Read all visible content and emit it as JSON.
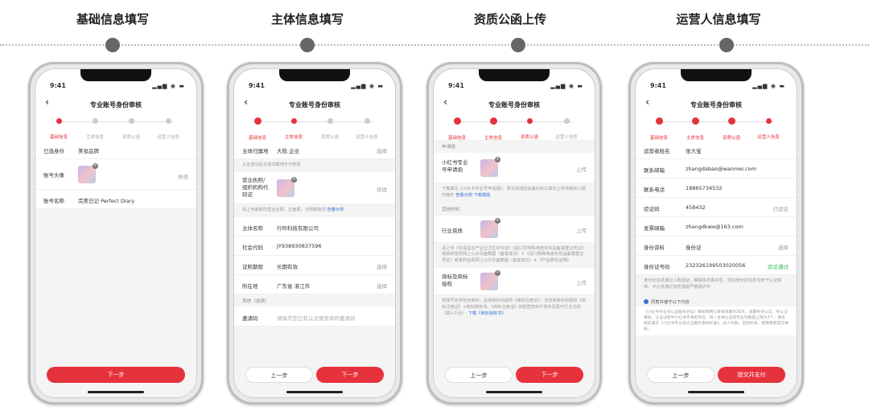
{
  "steps": [
    {
      "title": "基础信息填写"
    },
    {
      "title": "主体信息填写"
    },
    {
      "title": "资质公函上传"
    },
    {
      "title": "运营人信息填写"
    }
  ],
  "common": {
    "time": "9:41",
    "signal": "▂▄▆ ◉ ▬",
    "back": "‹",
    "page_title": "专业账号身份审核",
    "stepper": [
      "基础信息",
      "主体信息",
      "资质公函",
      "运营人信息"
    ],
    "prev_label": "上一步",
    "next_label": "下一步"
  },
  "phone1": {
    "rows": [
      {
        "k": "已选身份",
        "v": "美妆品牌"
      },
      {
        "k": "账号头像",
        "r": "修改"
      },
      {
        "k": "账号名称",
        "v": "完美日记 Perfect Diary"
      }
    ]
  },
  "phone2": {
    "r1": {
      "k": "主体归属地",
      "v": "大陆 企业",
      "r": "选择"
    },
    "hint1": "认证成功后主体归属地不可修改",
    "license": {
      "k": "营业执照/\n组织机构代\n码证",
      "r": "修改"
    },
    "hint2": "请上传最新的营业证照，正面照，无残缺信息",
    "hint2_link": "查看示例",
    "rows": [
      {
        "k": "主体名称",
        "v": "行吟科技有限公司",
        "r": ""
      },
      {
        "k": "社会代码",
        "v": "JY938930837596",
        "r": ""
      },
      {
        "k": "证照期限",
        "v": "长期有效",
        "r": "选择"
      },
      {
        "k": "所在地",
        "v": "广东省 湛江市",
        "r": "选择"
      }
    ],
    "other_title": "其他（选填）",
    "invite": {
      "k": "邀请码",
      "v": "请填写您已有认证服务商的邀请码"
    }
  },
  "phone3": {
    "sec1": "申请函",
    "app": {
      "k": "小红书专业\n号申请函",
      "r": "上传"
    },
    "hint1": "下载填写《小红书专业号申请函》，填写完成后加盖红色公章并上传清晰的公函扫描件",
    "hint1_links": "查看示例  下载模版",
    "sec2": "其他材料",
    "qual": {
      "k": "行业资质",
      "r": "上传"
    },
    "hint2": "请上传《化妆品生产企业卫生许可证》《进口非特殊用途化妆品备案登记凭证》或食药监局网上公示页面截图（备案成功）3.《进口特殊用途化妆品备案登记凭证》或食药监局网上公示页面截图（备案成功）4.《产品质检证明》",
    "tm": {
      "k": "商标及商标\n授权",
      "r": "上传"
    },
    "hint3": "若账号名称包含商标，且有商标则提供《商标注册证》，非自有商标则提供《商标注册证》+商标授权书。《商标注册证》的经营类目不得涉及医疗行业内容（禁入行业）",
    "hint3_link": "下载《商标授权书》"
  },
  "phone4": {
    "rows": [
      {
        "k": "运营者姓名",
        "v": "张大宝",
        "r": "",
        "green": false
      },
      {
        "k": "联系邮箱",
        "v": "zhangdabao@wanmei.com",
        "r": "",
        "green": false
      },
      {
        "k": "联系电话",
        "v": "18865734532",
        "r": "",
        "green": false
      },
      {
        "k": "验证码",
        "v": "458432",
        "r": "已验证",
        "green": false
      },
      {
        "k": "发票邮箱",
        "v": "zhangdkwe@163.com",
        "r": "",
        "green": false
      },
      {
        "k": "身份资料",
        "v": "身份证",
        "r": "选择",
        "green": false
      },
      {
        "k": "身份证号码",
        "v": "232326199503020056",
        "r": "验证通过",
        "green": true
      }
    ],
    "hint": "身份证信息通过人脸验证，确保信息真实性，您的身份证信息仅用于认证审核，平台将通过加密措施严格保护中",
    "agree": "同意并遵守以下内容",
    "agree_detail": "《小红书专业号认证服务协议》审核费用订单有效期为30天，逾期失效认证。经认证审核，认证过程中小红书不承担责任，同一主体认证的专业号数量上限为3个，请您如实填写《小红书专业号认证服务审核标准》，驳入付款，否则失效，需要重新提交审核。",
    "submit_label": "提交并支付"
  }
}
